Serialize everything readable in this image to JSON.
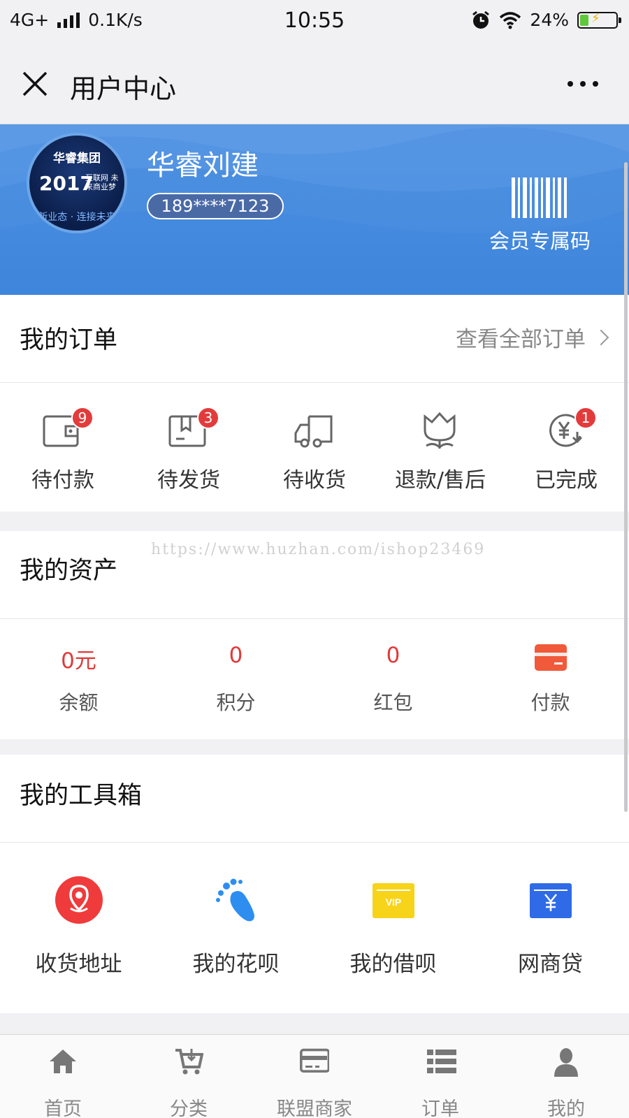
{
  "status_bar": {
    "network": "4G+",
    "speed": "0.1K/s",
    "time": "10:55",
    "battery": "24%",
    "battery_level": 0.24
  },
  "nav": {
    "title": "用户中心"
  },
  "profile": {
    "avatar_text": {
      "brand": "华睿集团",
      "year": "2017",
      "tagline": "互联网 未来商业梦",
      "slogan": "新业态 · 连接未来"
    },
    "name": "华睿刘建",
    "phone": "189****7123",
    "member_code_label": "会员专属码"
  },
  "orders": {
    "title": "我的订单",
    "view_all": "查看全部订单",
    "items": [
      {
        "label": "待付款",
        "badge": "9",
        "icon": "wallet-icon"
      },
      {
        "label": "待发货",
        "badge": "3",
        "icon": "box-icon"
      },
      {
        "label": "待收货",
        "badge": "",
        "icon": "truck-icon"
      },
      {
        "label": "退款/售后",
        "badge": "",
        "icon": "tulip-icon"
      },
      {
        "label": "已完成",
        "badge": "1",
        "icon": "yen-circle-icon"
      }
    ]
  },
  "watermark": "https://www.huzhan.com/ishop23469",
  "assets": {
    "title": "我的资产",
    "items": [
      {
        "value": "0元",
        "label": "余额"
      },
      {
        "value": "0",
        "label": "积分"
      },
      {
        "value": "0",
        "label": "红包"
      },
      {
        "value": "",
        "label": "付款",
        "icon": "card-icon"
      }
    ]
  },
  "toolbox": {
    "title": "我的工具箱",
    "items": [
      {
        "label": "收货地址",
        "icon": "location-pin-icon"
      },
      {
        "label": "我的花呗",
        "icon": "footprint-icon"
      },
      {
        "label": "我的借呗",
        "icon": "vip-ticket-icon"
      },
      {
        "label": "网商贷",
        "icon": "yen-ticket-icon"
      }
    ]
  },
  "tabbar": {
    "items": [
      {
        "label": "首页",
        "icon": "home-icon"
      },
      {
        "label": "分类",
        "icon": "cart-icon"
      },
      {
        "label": "联盟商家",
        "icon": "card-icon"
      },
      {
        "label": "订单",
        "icon": "list-icon"
      },
      {
        "label": "我的",
        "icon": "person-icon"
      }
    ]
  },
  "colors": {
    "banner": "#3e86dc",
    "badge": "#e33b3b",
    "asset_value": "#e03a3a",
    "location_pin": "#ef3b3b",
    "footprint": "#2d8ef0",
    "vip": "#f7d31a",
    "loan": "#2f6be6"
  }
}
